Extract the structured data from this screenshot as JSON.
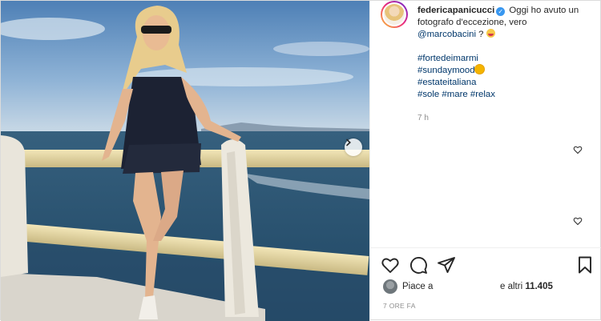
{
  "post": {
    "username": "federicapanicucci",
    "caption_text": "Oggi ho avuto un fotografo d'eccezione, vero",
    "mention": "@marcobacini",
    "mention_suffix": "?",
    "hashtags": [
      "#fortedeimarmi",
      "#sundaymood",
      "#estateitaliana"
    ],
    "last_tags": [
      "#sole",
      "#mare",
      "#relax"
    ],
    "timestamp": "7 h"
  },
  "likes": {
    "prefix": "Piace a",
    "suffix_text": "e altri",
    "count": "11.405"
  },
  "posted_ago": "7 ORE FA",
  "icons": {
    "verified": "verified-icon",
    "like": "heart-icon",
    "comment": "comment-icon",
    "share": "paper-plane-icon",
    "save": "bookmark-icon",
    "next": "chevron-right-icon"
  },
  "colors": {
    "link": "#00376b",
    "text": "#262626",
    "muted": "#8e8e8e",
    "verified": "#3897f0"
  }
}
